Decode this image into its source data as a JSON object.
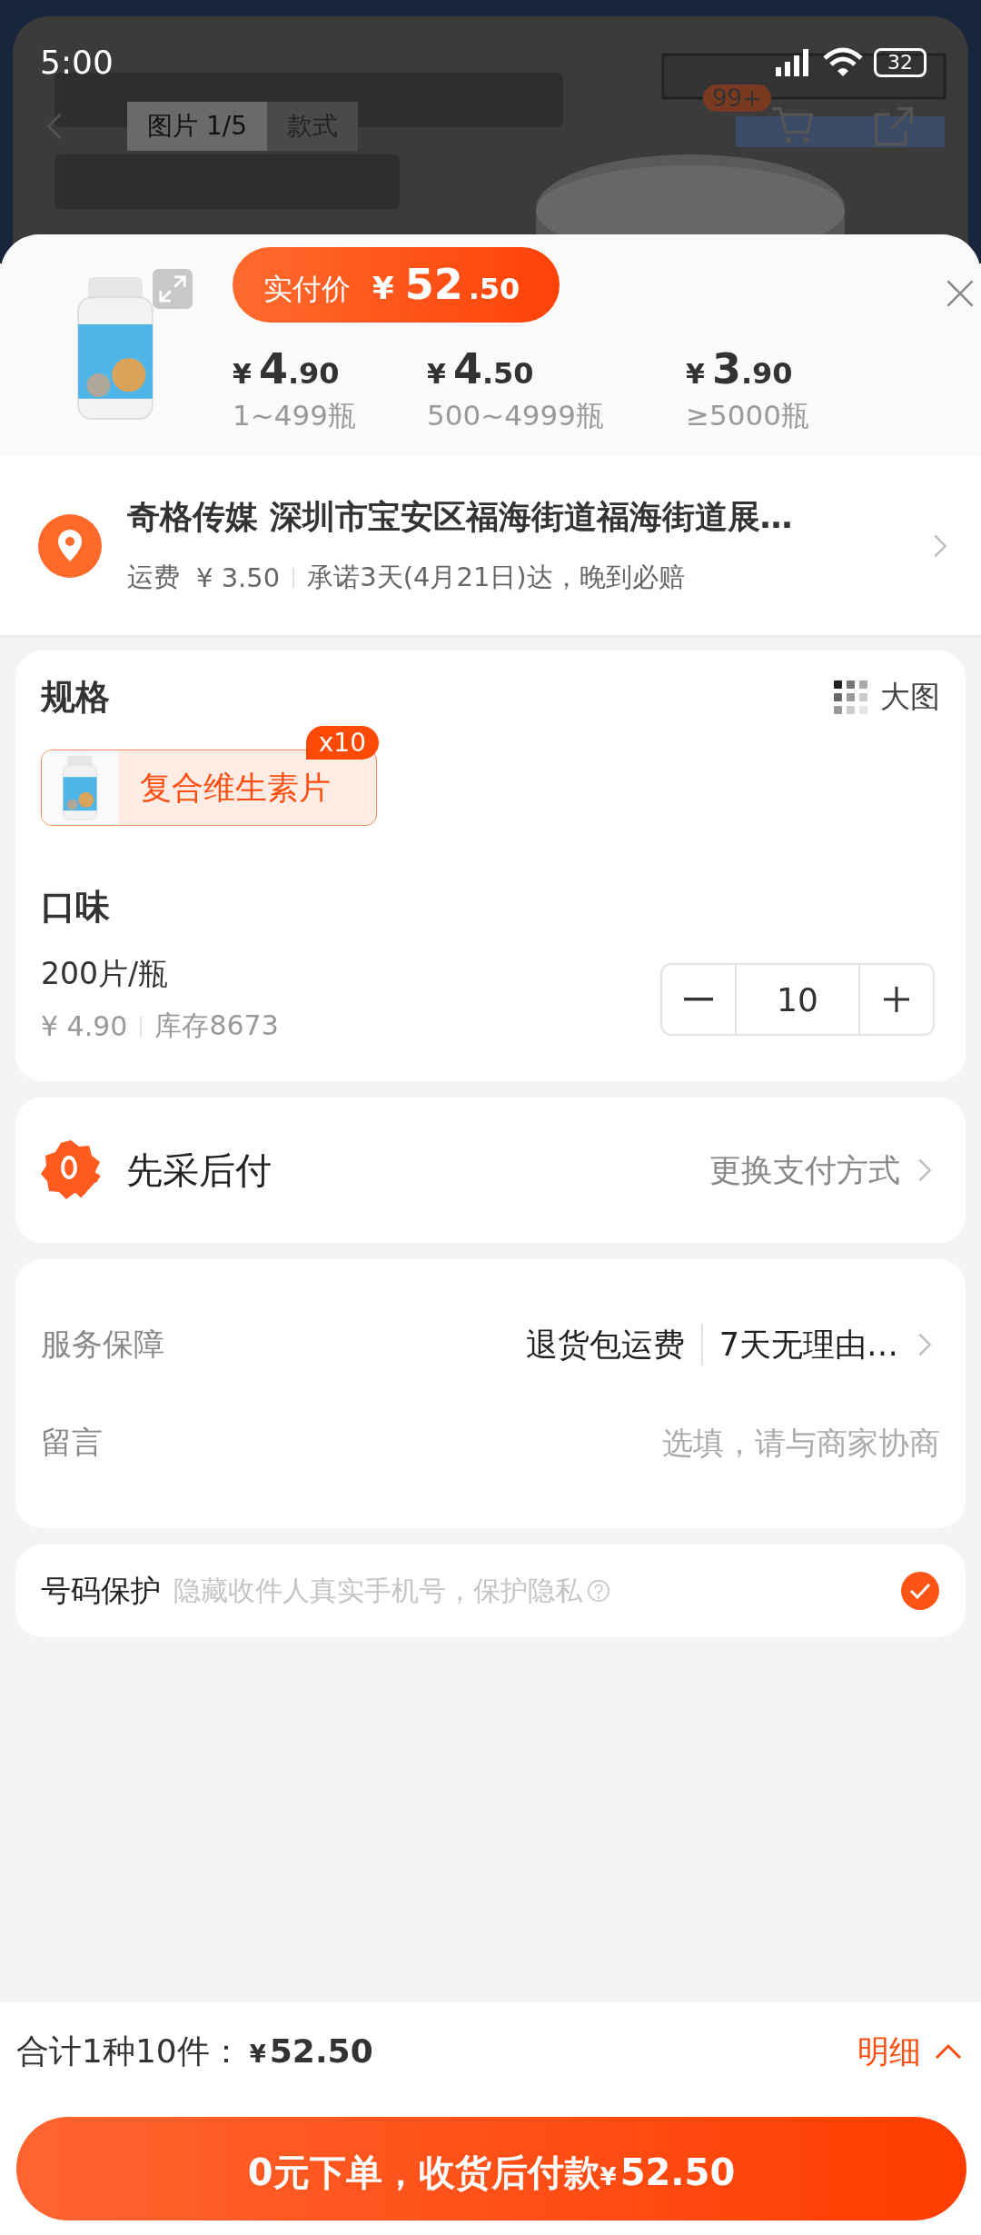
{
  "status_bar": {
    "time": "5:00",
    "battery": "32"
  },
  "gallery": {
    "tabs": [
      {
        "label": "图片 1/5",
        "selected": true
      },
      {
        "label": "款式",
        "selected": false
      }
    ],
    "cart_badge": "99+"
  },
  "header": {
    "paid_label": "实付价",
    "paid_currency": "¥",
    "paid_integer": "52",
    "paid_decimal": ".50",
    "tiers": [
      {
        "currency": "¥",
        "integer": "4",
        "decimal": ".90",
        "range": "1~499瓶"
      },
      {
        "currency": "¥",
        "integer": "4",
        "decimal": ".50",
        "range": "500~4999瓶"
      },
      {
        "currency": "¥",
        "integer": "3",
        "decimal": ".90",
        "range": "≥5000瓶"
      }
    ]
  },
  "address": {
    "line": "奇格传媒 深圳市宝安区福海街道福海街道展…",
    "shipping_label": "运费",
    "shipping_fee": "¥ 3.50",
    "promise": "承诺3天(4月21日)达，晚到必赔"
  },
  "spec": {
    "title": "规格",
    "view_toggle": "大图",
    "options": [
      {
        "label": "复合维生素片",
        "badge": "x10",
        "selected": true
      }
    ]
  },
  "flavor": {
    "title": "口味",
    "variants": [
      {
        "name": "200片/瓶",
        "price": "¥ 4.90",
        "stock": "库存8673",
        "quantity": "10"
      }
    ]
  },
  "payment": {
    "method": "先采后付",
    "change": "更换支付方式"
  },
  "service": {
    "rows": [
      {
        "kind": "link",
        "label": "服务保障",
        "values": [
          "退货包运费",
          "7天无理由…"
        ]
      },
      {
        "kind": "input",
        "label": "留言",
        "placeholder": "选填，请与商家协商"
      }
    ]
  },
  "privacy": {
    "label": "号码保护",
    "hint": "隐藏收件人真实手机号，保护隐私",
    "checked": true
  },
  "footer": {
    "summary": "合计1种10件：",
    "total_currency": "¥",
    "total": "52.50",
    "detail": "明细",
    "submit": "0元下单，收货后付款",
    "submit_currency": "¥",
    "submit_amount": "52.50"
  }
}
